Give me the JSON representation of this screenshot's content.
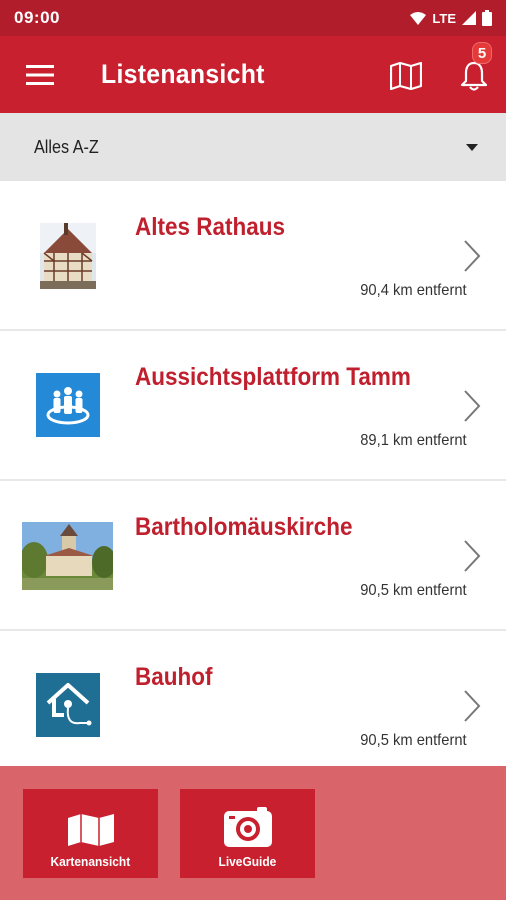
{
  "status_bar": {
    "time": "09:00",
    "network": "LTE",
    "icons": [
      "wifi-icon",
      "signal-icon",
      "battery-icon"
    ]
  },
  "app_bar": {
    "title": "Listenansicht",
    "notification_count": "5",
    "icons": [
      "menu-icon",
      "map-icon",
      "bell-icon"
    ]
  },
  "filter": {
    "selected": "Alles A-Z"
  },
  "items": [
    {
      "title": "Altes Rathaus",
      "distance": "90,4 km entfernt",
      "thumbnail": "photo"
    },
    {
      "title": "Aussichtsplattform Tamm",
      "distance": "89,1 km entfernt",
      "thumbnail": "viewpoint-icon"
    },
    {
      "title": "Bartholomäuskirche",
      "distance": "90,5 km entfernt",
      "thumbnail": "photo"
    },
    {
      "title": "Bauhof",
      "distance": "90,5 km entfernt",
      "thumbnail": "utility-icon"
    }
  ],
  "bottom": {
    "map_label": "Kartenansicht",
    "liveguide_label": "LiveGuide"
  },
  "colors": {
    "primary": "#c8202f",
    "status_bar": "#b11d2b",
    "bottom_panel": "#d9646a",
    "icon_blue": "#2489d6",
    "icon_teal": "#1f6e93"
  }
}
